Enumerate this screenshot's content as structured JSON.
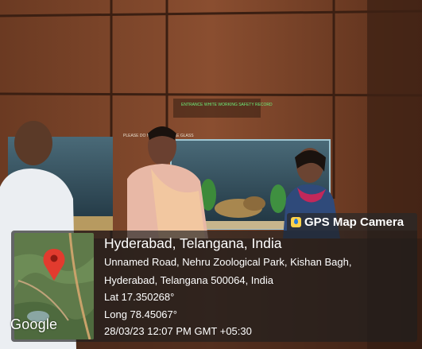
{
  "photo": {
    "wall_sign_left": "PLEASE DO NOT TOUCH THE GLASS",
    "wall_sign_right": "ENTRANCE WHITE WORKING SAFETY RECORD"
  },
  "overlay": {
    "app_name": "GPS Map Camera",
    "location_title": "Hyderabad, Telangana, India",
    "address_line1": "Unnamed Road, Nehru Zoological Park, Kishan Bagh,",
    "address_line2": "Hyderabad, Telangana 500064, India",
    "latitude": "Lat 17.350268°",
    "longitude": "Long 78.45067°",
    "datetime": "28/03/23 12:07 PM GMT +05:30",
    "map_attribution": "Google",
    "pin_color": "#e23b2e",
    "panel_color": "#1e1e1e"
  }
}
